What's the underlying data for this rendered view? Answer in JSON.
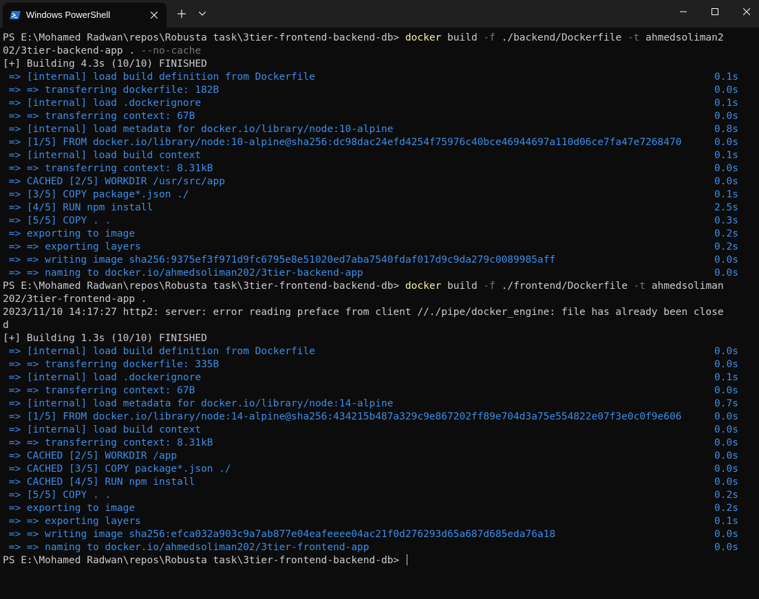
{
  "window": {
    "tab_title": "Windows PowerShell",
    "new_tab_icon": "plus-icon",
    "dropdown_icon": "chevron-down-icon",
    "controls": [
      "minimize-icon",
      "maximize-icon",
      "close-icon"
    ]
  },
  "colors": {
    "background": "#0c0c0c",
    "text": "#cccccc",
    "step": "#3b8eea",
    "command": "#f9f1a5",
    "flag": "#767676"
  },
  "terminal": {
    "prompt1": {
      "prompt": "PS E:\\Mohamed Radwan\\repos\\Robusta task\\3tier-frontend-backend-db> ",
      "cmd": "docker",
      "a1": " build ",
      "f1": "-f",
      "a2": " ./backend/Dockerfile ",
      "f2": "-t",
      "a3": " ahmedsoliman2",
      "wrap_text": "02/3tier-backend-app . ",
      "wrap_flag": "--no-cache"
    },
    "build1_header": "[+] Building 4.3s (10/10) FINISHED",
    "build1_steps": [
      {
        "text": " => [internal] load build definition from Dockerfile",
        "time": "0.1s"
      },
      {
        "text": " => => transferring dockerfile: 182B",
        "time": "0.0s"
      },
      {
        "text": " => [internal] load .dockerignore",
        "time": "0.1s"
      },
      {
        "text": " => => transferring context: 67B",
        "time": "0.0s"
      },
      {
        "text": " => [internal] load metadata for docker.io/library/node:10-alpine",
        "time": "0.8s"
      },
      {
        "text": " => [1/5] FROM docker.io/library/node:10-alpine@sha256:dc98dac24efd4254f75976c40bce46944697a110d06ce7fa47e7268470",
        "time": "0.0s"
      },
      {
        "text": " => [internal] load build context",
        "time": "0.1s"
      },
      {
        "text": " => => transferring context: 8.31kB",
        "time": "0.0s"
      },
      {
        "text": " => CACHED [2/5] WORKDIR /usr/src/app",
        "time": "0.0s"
      },
      {
        "text": " => [3/5] COPY package*.json ./",
        "time": "0.1s"
      },
      {
        "text": " => [4/5] RUN npm install",
        "time": "2.5s"
      },
      {
        "text": " => [5/5] COPY . .",
        "time": "0.3s"
      },
      {
        "text": " => exporting to image",
        "time": "0.2s"
      },
      {
        "text": " => => exporting layers",
        "time": "0.2s"
      },
      {
        "text": " => => writing image sha256:9375ef3f971d9fc6795e8e51020ed7aba7540fdaf017d9c9da279c0089985aff",
        "time": "0.0s"
      },
      {
        "text": " => => naming to docker.io/ahmedsoliman202/3tier-backend-app",
        "time": "0.0s"
      }
    ],
    "prompt2": {
      "prompt": "PS E:\\Mohamed Radwan\\repos\\Robusta task\\3tier-frontend-backend-db> ",
      "cmd": "docker",
      "a1": " build ",
      "f1": "-f",
      "a2": " ./frontend/Dockerfile ",
      "f2": "-t",
      "a3": " ahmedsoliman",
      "wrap_text": "202/3tier-frontend-app ."
    },
    "error_line1": "2023/11/10 14:17:27 http2: server: error reading preface from client //./pipe/docker_engine: file has already been close",
    "error_line2": "d",
    "build2_header": "[+] Building 1.3s (10/10) FINISHED",
    "build2_steps": [
      {
        "text": " => [internal] load build definition from Dockerfile",
        "time": "0.0s"
      },
      {
        "text": " => => transferring dockerfile: 335B",
        "time": "0.0s"
      },
      {
        "text": " => [internal] load .dockerignore",
        "time": "0.1s"
      },
      {
        "text": " => => transferring context: 67B",
        "time": "0.0s"
      },
      {
        "text": " => [internal] load metadata for docker.io/library/node:14-alpine",
        "time": "0.7s"
      },
      {
        "text": " => [1/5] FROM docker.io/library/node:14-alpine@sha256:434215b487a329c9e867202ff89e704d3a75e554822e07f3e0c0f9e606",
        "time": "0.0s"
      },
      {
        "text": " => [internal] load build context",
        "time": "0.0s"
      },
      {
        "text": " => => transferring context: 8.31kB",
        "time": "0.0s"
      },
      {
        "text": " => CACHED [2/5] WORKDIR /app",
        "time": "0.0s"
      },
      {
        "text": " => CACHED [3/5] COPY package*.json ./",
        "time": "0.0s"
      },
      {
        "text": " => CACHED [4/5] RUN npm install",
        "time": "0.0s"
      },
      {
        "text": " => [5/5] COPY . .",
        "time": "0.2s"
      },
      {
        "text": " => exporting to image",
        "time": "0.2s"
      },
      {
        "text": " => => exporting layers",
        "time": "0.1s"
      },
      {
        "text": " => => writing image sha256:efca032a903c9a7ab877e04eafeeee04ac21f0d276293d65a687d685eda76a18",
        "time": "0.0s"
      },
      {
        "text": " => => naming to docker.io/ahmedsoliman202/3tier-frontend-app",
        "time": "0.0s"
      }
    ],
    "final_prompt": "PS E:\\Mohamed Radwan\\repos\\Robusta task\\3tier-frontend-backend-db> "
  }
}
